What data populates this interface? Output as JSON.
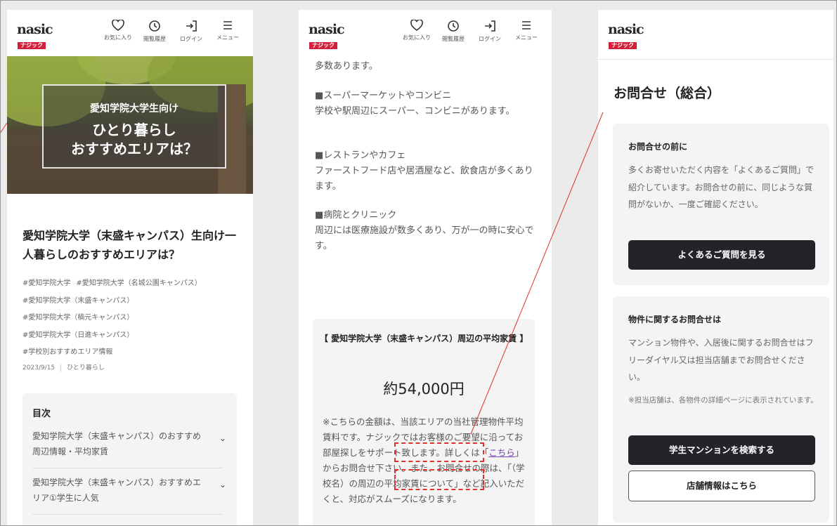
{
  "header": {
    "logo_top": "nasic",
    "logo_bottom": "ナジック",
    "nav": [
      {
        "label": "お気に入り",
        "icon": "heart-icon"
      },
      {
        "label": "閲覧履歴",
        "icon": "history-icon"
      },
      {
        "label": "ログイン",
        "icon": "login-icon"
      },
      {
        "label": "メニュー",
        "icon": "menu-icon"
      }
    ]
  },
  "panel1": {
    "hero": {
      "subtitle": "愛知学院大学生向け",
      "title_line1": "ひとり暮らし",
      "title_line2": "おすすめエリアは？"
    },
    "article_title": "愛知学院大学（末盛キャンパス）生向け一人暮らしのおすすめエリアは？",
    "tags": [
      "#愛知学院大学",
      "#愛知学院大学（名城公園キャンパス）",
      "#愛知学院大学（末盛キャンパス）",
      "#愛知学院大学（楠元キャンパス）",
      "#愛知学院大学（日進キャンパス）",
      "#学校別おすすめエリア情報"
    ],
    "date": "2023/9/15",
    "category": "ひとり暮らし",
    "toc": {
      "heading": "目次",
      "items": [
        "愛知学院大学（末盛キャンパス）のおすすめ周辺情報・平均家賃",
        "愛知学院大学（末盛キャンパス）おすすめエリア①学生に人気"
      ]
    }
  },
  "panel2": {
    "intro": "多数あります。",
    "sections": [
      {
        "heading": "■スーパーマーケットやコンビニ",
        "text": "学校や駅周辺にスーパー、コンビニがあります。"
      },
      {
        "heading": "■レストランやカフェ",
        "text": "ファーストフード店や居酒屋など、飲食店が多くあります。"
      },
      {
        "heading": "■病院とクリニック",
        "text": "周辺には医療施設が数多くあり、万が一の時に安心です。"
      }
    ],
    "rent_box": {
      "title": "【 愛知学院大学（末盛キャンパス）周辺の平均家賃 】",
      "price": "約54,000円",
      "note_before": "※こちらの金額は、当該エリアの当社管理物件平均賃料です。ナジックではお客様のご要望に沿ってお部屋探しをサポート致します。詳しくは「",
      "note_link": "こちら",
      "note_after": "」からお問合せ下さい。また、お問合せの際は、「（学校名）の周辺の平均家賃について」など記入いただくと、対応がスムーズになります。"
    }
  },
  "panel3": {
    "page_title": "お問合せ（総合）",
    "card1": {
      "heading": "お問合せの前に",
      "body": "多くお寄せいただく内容を「よくあるご質問」で紹介しています。お問合せの前に、同じような質問がないか、一度ご確認ください。",
      "button": "よくあるご質問を見る"
    },
    "card2": {
      "heading": "物件に関するお問合せは",
      "body": "マンション物件や、入居後に関するお問合せはフリーダイヤル又は担当店舗までお問合せください。",
      "note": "※担当店舗は、各物件の詳細ページに表示されています。",
      "button_primary": "学生マンションを検索する",
      "button_secondary": "店舗情報はこちら"
    }
  },
  "colors": {
    "accent_red": "#d21f3a",
    "annotation_red": "#e0302c",
    "button_dark": "#222429",
    "link_purple": "#7b3fb5"
  }
}
